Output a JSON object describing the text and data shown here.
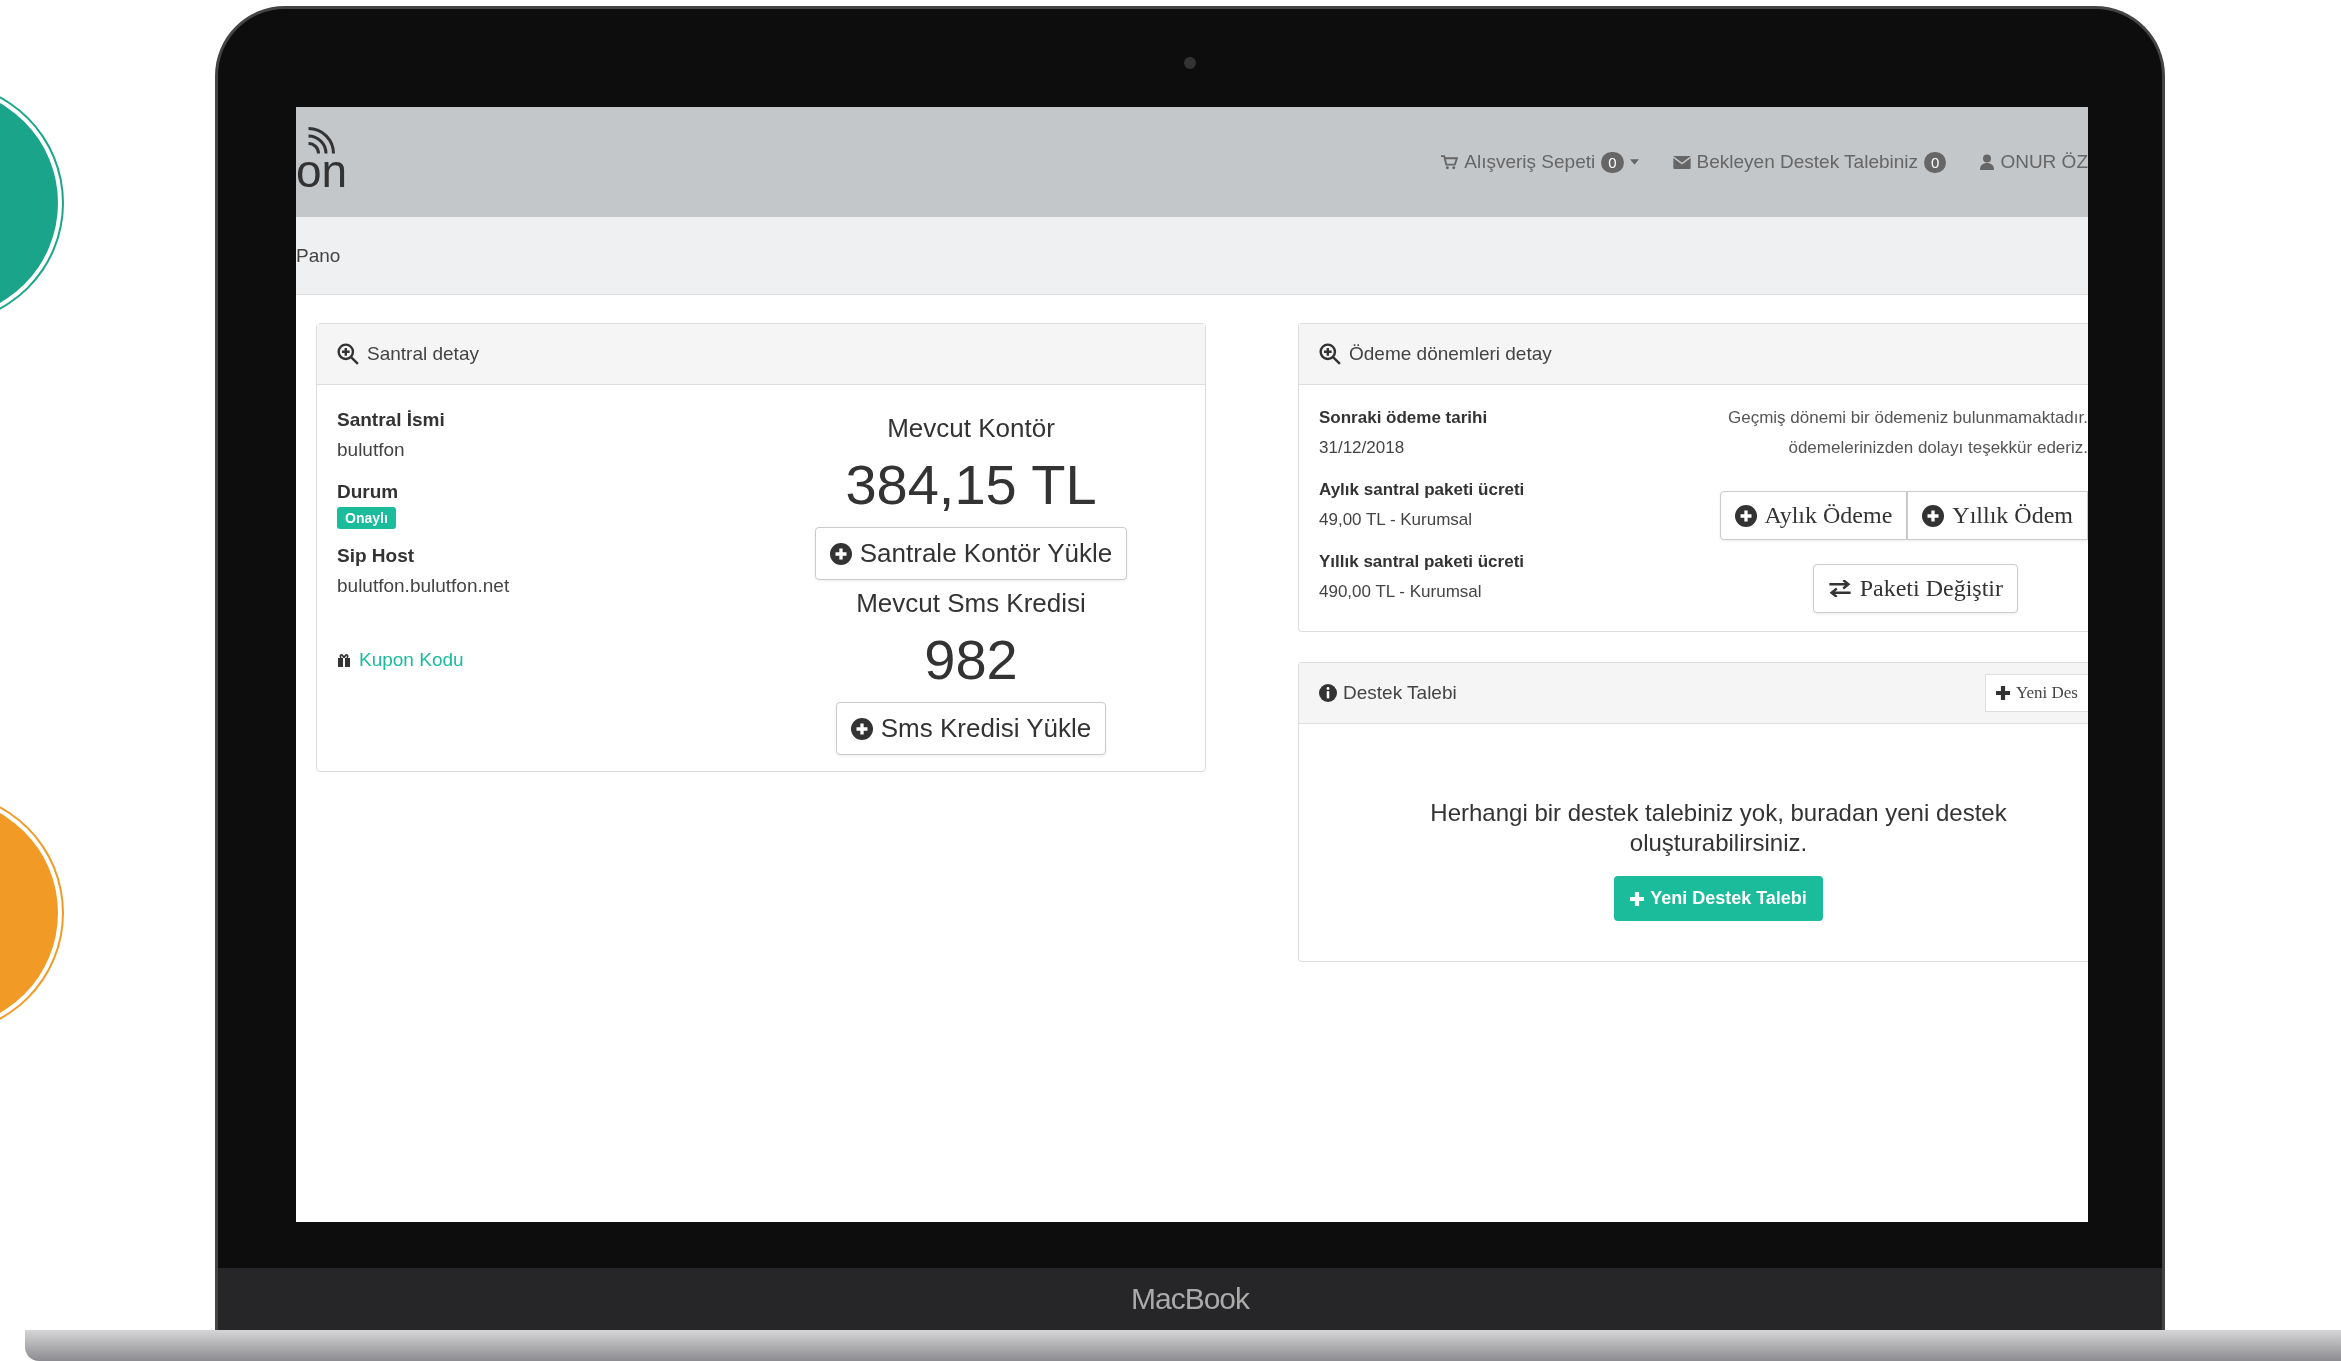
{
  "laptop": {
    "label": "MacBook"
  },
  "header": {
    "logo": "on",
    "nav": [
      {
        "kind": "cart",
        "label": "Alışveriş Sepeti",
        "badge": "0",
        "dropdown": true
      },
      {
        "kind": "mail",
        "label": "Bekleyen Destek Talebiniz",
        "badge": "0",
        "dropdown": false
      },
      {
        "kind": "user",
        "label": "ONUR ÖZ",
        "dropdown": false
      }
    ]
  },
  "breadcrumb": "Pano",
  "santral_card": {
    "title": "Santral detay",
    "fields": [
      {
        "kind": "text",
        "label": "Santral İsmi",
        "value": "bulutfon"
      },
      {
        "kind": "badge",
        "label": "Durum",
        "value": "Onaylı"
      },
      {
        "kind": "text",
        "label": "Sip Host",
        "value": "bulutfon.bulutfon.net"
      }
    ],
    "coupon_link": "Kupon Kodu",
    "balances": [
      {
        "label": "Mevcut Kontör",
        "value": "384,15 TL",
        "button": "Santrale Kontör Yükle"
      },
      {
        "label": "Mevcut Sms Kredisi",
        "value": "982",
        "button": "Sms Kredisi Yükle"
      }
    ]
  },
  "payment_card": {
    "title": "Ödeme dönemleri detay",
    "fields": [
      {
        "label": "Sonraki ödeme tarihi",
        "value": "31/12/2018"
      },
      {
        "label": "Aylık santral paketi ücreti",
        "value": "49,00 TL - Kurumsal"
      },
      {
        "label": "Yıllık santral paketi ücreti",
        "value": "490,00 TL - Kurumsal"
      }
    ],
    "message": [
      "Geçmiş dönemi bir ödemeniz bulunmamaktadır.",
      "ödemelerinizden dolayı teşekkür ederiz."
    ],
    "pay_buttons": [
      "Aylık Ödeme",
      "Yıllık Ödem"
    ],
    "change_button": "Paketi Değiştir"
  },
  "support_card": {
    "title": "Destek Talebi",
    "header_button": "Yeni Des",
    "message": "Herhangi bir destek talebiniz yok, buradan yeni destek oluşturabilirsiniz.",
    "button": "Yeni Destek Talebi"
  }
}
